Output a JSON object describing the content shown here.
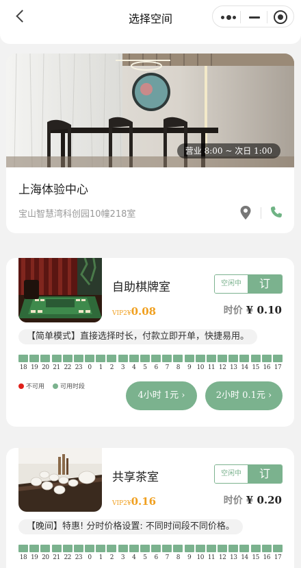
{
  "nav": {
    "title": "选择空间"
  },
  "store": {
    "name": "上海体验中心",
    "address": "宝山智慧湾科创园10幢218室",
    "hours": "营业 8:00 ~ 次日 1:00"
  },
  "colors": {
    "accent": "#7bb28e",
    "vip": "#f0a020",
    "unavailable": "#e0201a"
  },
  "rooms": [
    {
      "name": "自助棋牌室",
      "vip_tag": "VIP2¥",
      "vip_price": "0.08",
      "status": "空闲中",
      "book_label": "订",
      "hour_label": "时价",
      "hour_price": "¥ 0.10",
      "mode_text": "【简单模式】直接选择时长，付款立即开单，快捷易用。",
      "legend_unavailable": "不可用",
      "legend_available": "可用时段",
      "packages": [
        "4小时 1元 ›",
        "2小时 0.1元 ›"
      ]
    },
    {
      "name": "共享茶室",
      "vip_tag": "VIP2¥",
      "vip_price": "0.16",
      "status": "空闲中",
      "book_label": "订",
      "hour_label": "时价",
      "hour_price": "¥ 0.20",
      "mode_text": "【晚间】特惠! 分时价格设置: 不同时间段不同价格。"
    }
  ],
  "timeline_hours": [
    "18",
    "19",
    "20",
    "21",
    "22",
    "23",
    "0",
    "1",
    "2",
    "3",
    "4",
    "5",
    "6",
    "7",
    "8",
    "9",
    "10",
    "11",
    "12",
    "13",
    "14",
    "15",
    "16",
    "17"
  ]
}
